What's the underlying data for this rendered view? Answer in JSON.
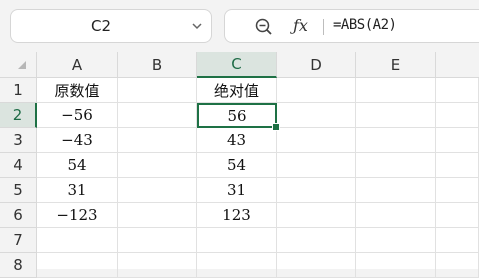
{
  "name_box": {
    "value": "C2"
  },
  "formula_bar": {
    "formula": "=ABS(A2)"
  },
  "icons": {
    "zoom": "zoom-icon",
    "fx": "function-icon",
    "chevron": "chevron-down-icon"
  },
  "columns": [
    "A",
    "B",
    "C",
    "D",
    "E"
  ],
  "rows": [
    "1",
    "2",
    "3",
    "4",
    "5",
    "6",
    "7",
    "8"
  ],
  "active": {
    "column": "C",
    "row": "2"
  },
  "cells": {
    "A1": "原数值",
    "A2": "−56",
    "A3": "−43",
    "A4": "54",
    "A5": "31",
    "A6": "−123",
    "C1": "绝对值",
    "C2": "56",
    "C3": "43",
    "C4": "54",
    "C5": "31",
    "C6": "123"
  },
  "colors": {
    "accent": "#1e7145",
    "header_bg": "#f3f3f3",
    "active_header_bg": "#dbe4df",
    "gridline": "#e1e1e1"
  }
}
